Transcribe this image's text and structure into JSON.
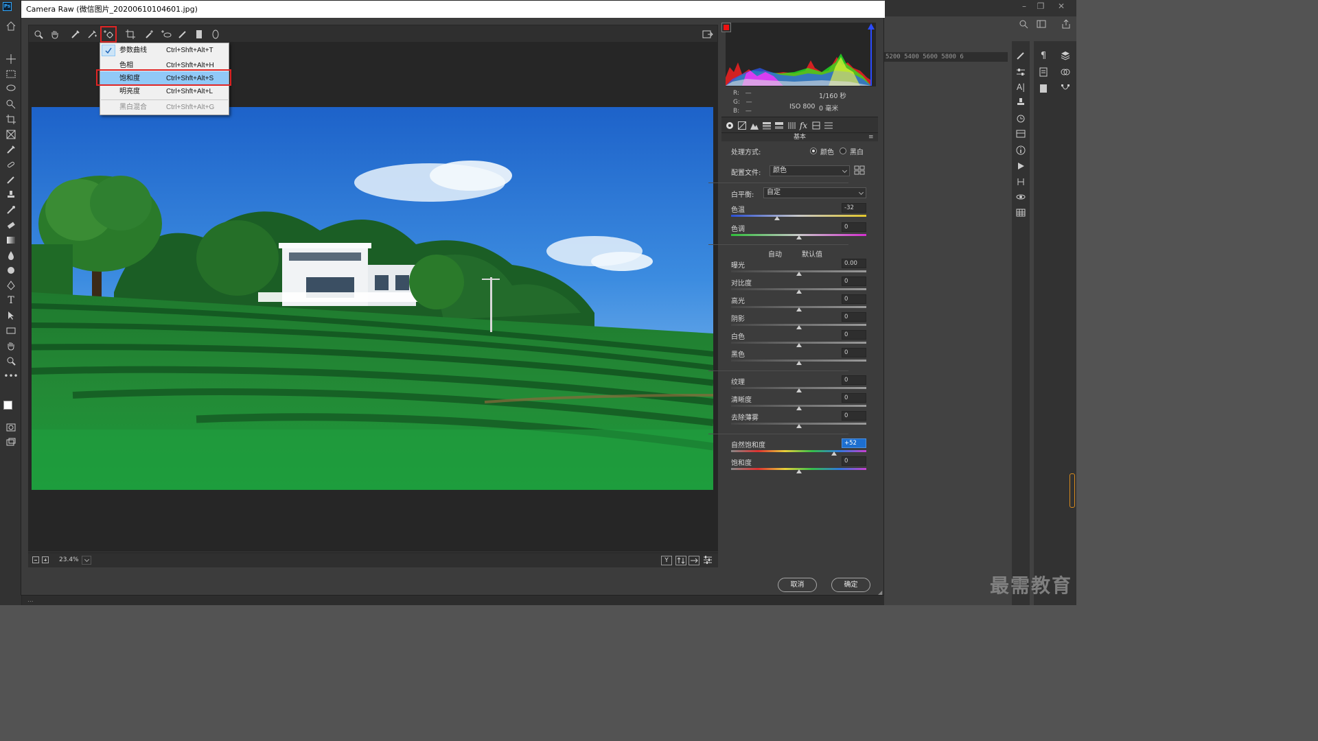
{
  "window": {
    "title": "Camera Raw (微信图片_20200610104601.jpg)",
    "watermark": "最需教育",
    "status_text": "...",
    "ruler_text": "5200    5400    5600    5800    6"
  },
  "menu": {
    "items": [
      {
        "label": "参数曲线",
        "shortcut": "Ctrl+Shft+Alt+T",
        "checked": true
      },
      {
        "label": "色相",
        "shortcut": "Ctrl+Shft+Alt+H"
      },
      {
        "label": "饱和度",
        "shortcut": "Ctrl+Shft+Alt+S",
        "selected": true
      },
      {
        "label": "明亮度",
        "shortcut": "Ctrl+Shft+Alt+L"
      },
      {
        "label": "黑白混合",
        "shortcut": "Ctrl+Shft+Alt+G",
        "disabled": true
      }
    ]
  },
  "info": {
    "r_label": "R:",
    "r_value": "—",
    "g_label": "G:",
    "g_value": "—",
    "b_label": "B:",
    "b_value": "—",
    "shutter": "1/160 秒",
    "iso": "ISO 800",
    "focal": "0 毫米"
  },
  "panel": {
    "section_title": "基本",
    "treatment": {
      "label": "处理方式:",
      "color": "颜色",
      "bw": "黑白",
      "selected": "color"
    },
    "profile": {
      "label": "配置文件:",
      "value": "颜色"
    },
    "white_balance": {
      "label": "白平衡:",
      "value": "自定"
    },
    "auto_label": "自动",
    "default_label": "默认值",
    "sliders": {
      "temp": {
        "label": "色温",
        "value": "-32",
        "pos": 0.34
      },
      "tint": {
        "label": "色调",
        "value": "0",
        "pos": 0.5
      },
      "exposure": {
        "label": "曝光",
        "value": "0.00",
        "pos": 0.5
      },
      "contrast": {
        "label": "对比度",
        "value": "0",
        "pos": 0.5
      },
      "highlights": {
        "label": "高光",
        "value": "0",
        "pos": 0.5
      },
      "shadows": {
        "label": "阴影",
        "value": "0",
        "pos": 0.5
      },
      "whites": {
        "label": "白色",
        "value": "0",
        "pos": 0.5
      },
      "blacks": {
        "label": "黑色",
        "value": "0",
        "pos": 0.5
      },
      "texture": {
        "label": "纹理",
        "value": "0",
        "pos": 0.5
      },
      "clarity": {
        "label": "清晰度",
        "value": "0",
        "pos": 0.5
      },
      "dehaze": {
        "label": "去除薄雾",
        "value": "0",
        "pos": 0.5
      },
      "vibrance": {
        "label": "自然饱和度",
        "value": "+52",
        "pos": 0.76
      },
      "saturation": {
        "label": "饱和度",
        "value": "0",
        "pos": 0.5
      }
    }
  },
  "footer": {
    "zoom": "23.4%",
    "cancel": "取消",
    "ok": "确定"
  },
  "colors": {
    "highlight_red": "#e02424",
    "menu_selected": "#91c9f7",
    "accent_blue": "#1d6fd0"
  }
}
